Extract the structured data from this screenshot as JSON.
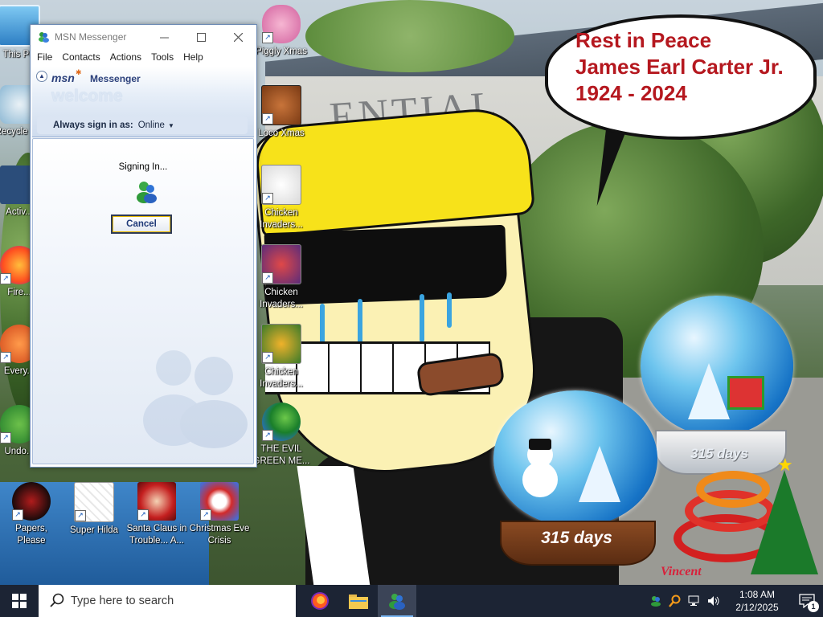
{
  "wallpaper": {
    "building_letters": "ENTIAL",
    "bubble_lines": [
      "Rest in Peace",
      "James Earl Carter Jr.",
      "1924 - 2024"
    ],
    "globe_left_label": "315 days",
    "globe_right_label": "315 days",
    "signature": "Vincent"
  },
  "desktop_icons": [
    {
      "label": "This PC",
      "icon": "computer-icon"
    },
    {
      "label": "Recycle Bin",
      "icon": "recycle-bin-icon"
    },
    {
      "label": "Activ...",
      "icon": "activision-icon"
    },
    {
      "label": "Fire...",
      "icon": "firefox-icon"
    },
    {
      "label": "Every...",
      "icon": "everything-icon"
    },
    {
      "label": "Undo...",
      "icon": "undo-icon"
    },
    {
      "label": "Piggly Xmas",
      "icon": "piggy-icon"
    },
    {
      "label": "Loco Xmas",
      "icon": "bear-icon"
    },
    {
      "label": "Chicken Invaders...",
      "icon": "chicken-invaders-icon"
    },
    {
      "label": "Chicken Invaders...",
      "icon": "chicken-invaders-2-icon"
    },
    {
      "label": "Chicken Invaders...",
      "icon": "chicken-invaders-3-icon"
    },
    {
      "label": "THE EVIL GREEN ME...",
      "icon": "evil-green-messenger-icon"
    },
    {
      "label": "Papers, Please",
      "icon": "papers-please-icon"
    },
    {
      "label": "Super Hilda",
      "icon": "super-hilda-icon"
    },
    {
      "label": "Santa Claus in Trouble... A...",
      "icon": "santa-trouble-icon"
    },
    {
      "label": "Christmas Eve Crisis",
      "icon": "christmas-eve-crisis-icon"
    }
  ],
  "msn": {
    "window_title": "MSN Messenger",
    "menu": [
      "File",
      "Contacts",
      "Actions",
      "Tools",
      "Help"
    ],
    "logo": "msn",
    "logo_sub": "Messenger",
    "welcome": "welcome",
    "always_sign_in_label": "Always sign in as:",
    "status_value": "Online",
    "signing_in": "Signing In...",
    "cancel": "Cancel"
  },
  "taskbar": {
    "search_placeholder": "Type here to search",
    "apps": [
      "firefox-icon",
      "file-explorer-icon",
      "msn-messenger-icon"
    ],
    "time": "1:08 AM",
    "date": "2/12/2025",
    "notification_count": "1"
  },
  "colors": {
    "taskbar": "#1c2434",
    "bubble_text": "#b5181f",
    "msn_accent": "#2a3f7a",
    "hair_yellow": "#f7e21a"
  }
}
